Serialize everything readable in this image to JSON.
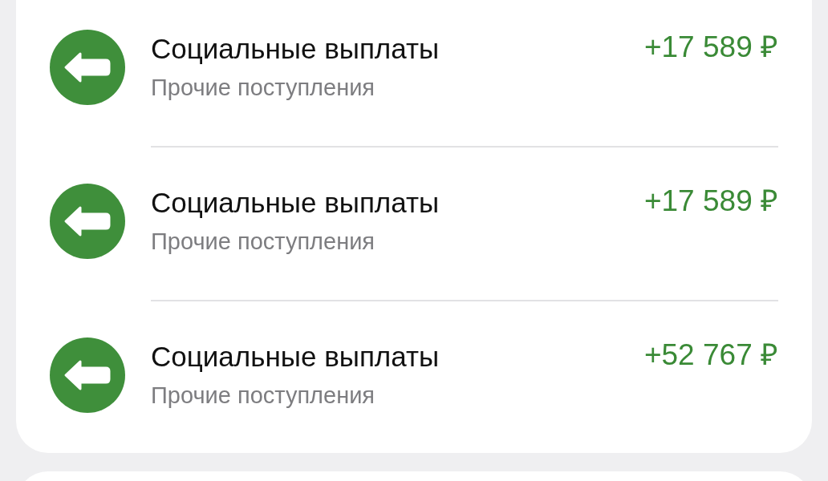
{
  "transactions": [
    {
      "title": "Социальные выплаты",
      "category": "Прочие поступления",
      "amount": "+17 589 ₽"
    },
    {
      "title": "Социальные выплаты",
      "category": "Прочие поступления",
      "amount": "+17 589 ₽"
    },
    {
      "title": "Социальные выплаты",
      "category": "Прочие поступления",
      "amount": "+52 767 ₽"
    }
  ]
}
